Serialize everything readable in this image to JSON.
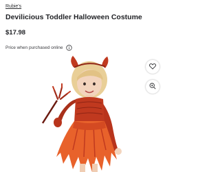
{
  "product": {
    "brand": "Rubie's",
    "title": "Devilicious Toddler Halloween Costume",
    "price": "$17.98",
    "price_note": "Price when purchased online"
  },
  "icons": {
    "info": "info-icon",
    "favorite": "heart-icon",
    "zoom": "zoom-in-icon"
  },
  "colors": {
    "text": "#1f2024",
    "costume_red": "#c0391f",
    "costume_orange": "#e8622b"
  }
}
